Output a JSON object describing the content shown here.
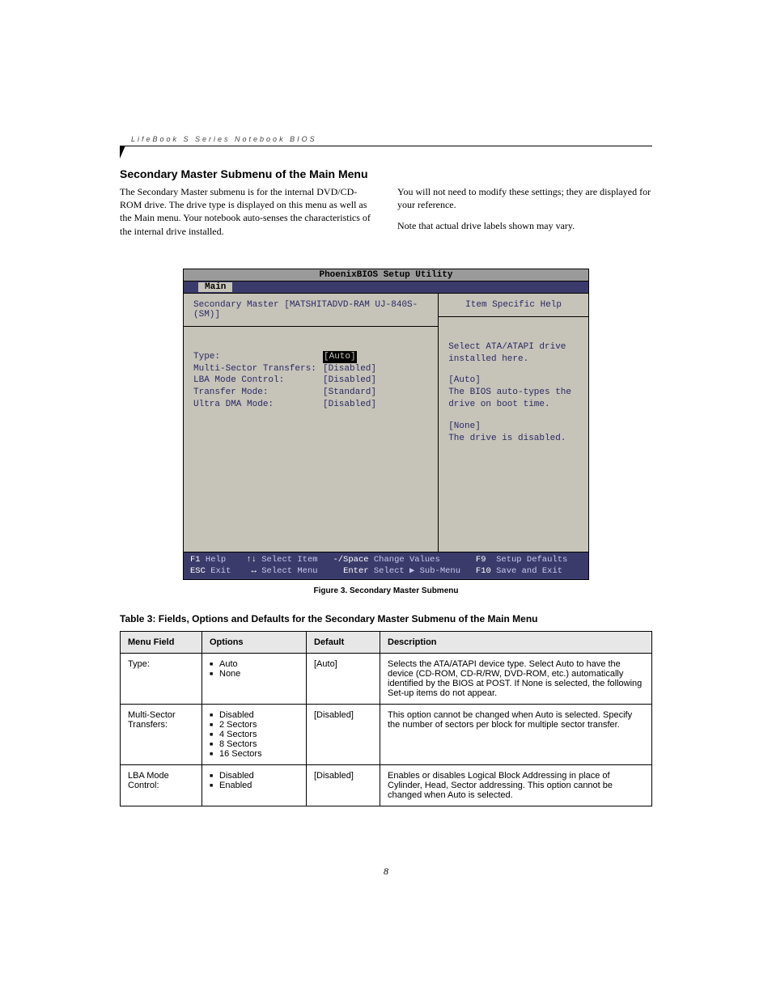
{
  "runhead": "LifeBook S Series Notebook BIOS",
  "section_title": "Secondary Master Submenu of the Main Menu",
  "col_left_p": "The Secondary Master submenu is for the internal DVD/CD-ROM drive. The drive type is displayed on this menu as well as the Main menu. Your notebook auto-senses the characteristics of the internal drive installed.",
  "col_right_p1": "You will not need to modify these settings;  they are displayed for your reference.",
  "col_right_p2": "Note that actual drive labels shown may vary.",
  "bios": {
    "title": "PhoenixBIOS Setup Utility",
    "tab": "Main",
    "left_header": "Secondary Master [MATSHITADVD-RAM UJ-840S-(SM)]",
    "right_header": "Item Specific Help",
    "rows": [
      {
        "label": "Type:",
        "value": "[Auto]",
        "highlight": true
      },
      {
        "label": "",
        "value": ""
      },
      {
        "label": "Multi-Sector Transfers:",
        "value": "[Disabled]"
      },
      {
        "label": "LBA Mode Control:",
        "value": "[Disabled]"
      },
      {
        "label": "Transfer Mode:",
        "value": "[Standard]"
      },
      {
        "label": "Ultra DMA Mode:",
        "value": "[Disabled]"
      }
    ],
    "help": [
      "Select ATA/ATAPI drive installed here.",
      "[Auto]\nThe BIOS auto-types the drive on boot time.",
      "[None]\nThe drive is disabled."
    ],
    "footer": {
      "r1": {
        "k1": "F1",
        "t1": " Help    ",
        "k2": "↑↓",
        "t2": " Select Item   ",
        "k3": "-/Space",
        "t3": " Change Values       ",
        "k4": "F9",
        "t4": "  Setup Defaults"
      },
      "r2": {
        "k1": "ESC",
        "t1": " Exit    ",
        "k2": "↔",
        "t2": " Select Menu     ",
        "k3": "Enter",
        "t3": " Select ▶ Sub-Menu   ",
        "k4": "F10",
        "t4": " Save and Exit"
      }
    }
  },
  "figure_caption": "Figure 3.   Secondary Master Submenu",
  "table_caption": "Table 3: Fields, Options and Defaults for the Secondary Master Submenu of the Main Menu",
  "table": {
    "headers": {
      "c1": "Menu Field",
      "c2": "Options",
      "c3": "Default",
      "c4": "Description"
    },
    "rows": [
      {
        "field": "Type:",
        "options": [
          "Auto",
          "None"
        ],
        "default": "[Auto]",
        "desc": "Selects the ATA/ATAPI device type. Select Auto to have the device (CD-ROM, CD-R/RW, DVD-ROM, etc.) automatically identified by the BIOS at POST. If None is selected, the following Set-up items do not appear."
      },
      {
        "field": "Multi-Sector Transfers:",
        "options": [
          "Disabled",
          "2 Sectors",
          "4 Sectors",
          "8 Sectors",
          "16 Sectors"
        ],
        "default": "[Disabled]",
        "desc": "This option cannot be changed when Auto is selected. Specify the number of sectors per block for multiple sector transfer."
      },
      {
        "field": "LBA Mode Control:",
        "options": [
          "Disabled",
          "Enabled"
        ],
        "default": "[Disabled]",
        "desc": "Enables or disables Logical Block Addressing in place of Cylinder, Head, Sector addressing. This option cannot be changed when Auto is selected."
      }
    ]
  },
  "page_number": "8"
}
